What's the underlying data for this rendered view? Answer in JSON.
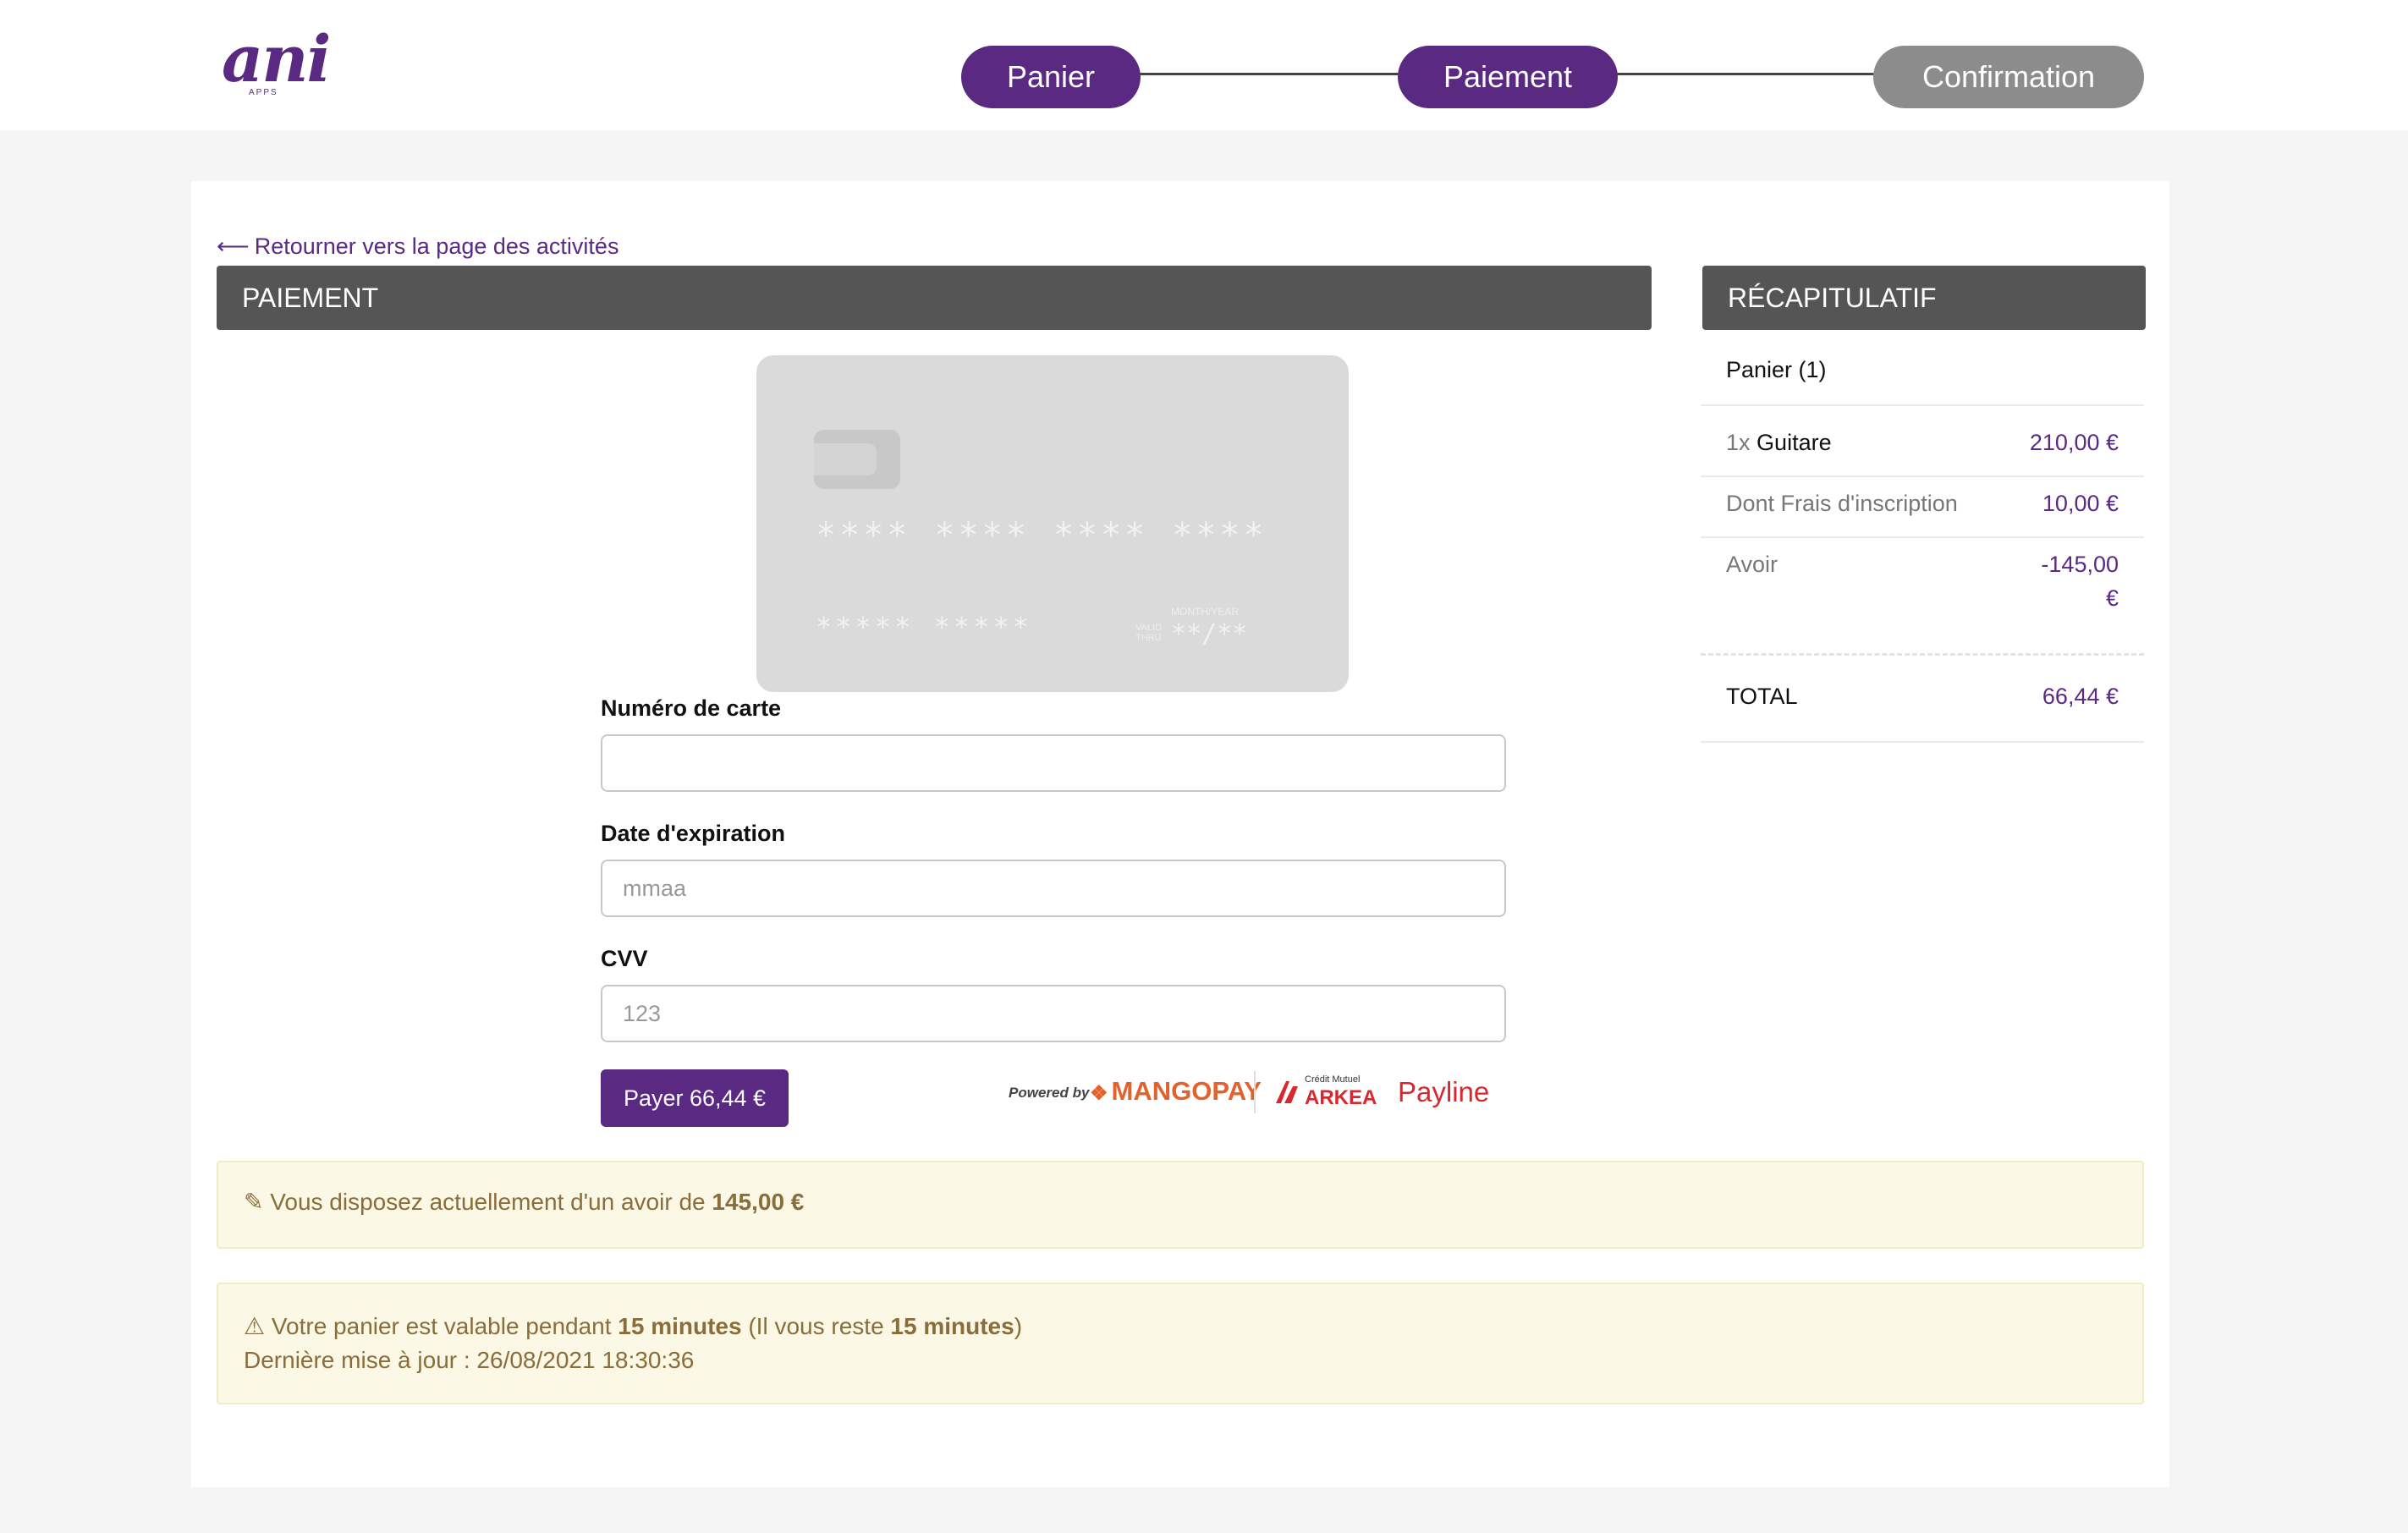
{
  "header": {
    "logo_text": "ani",
    "logo_subtext": "APPS",
    "steps": [
      {
        "label": "Panier",
        "state": "active"
      },
      {
        "label": "Paiement",
        "state": "active"
      },
      {
        "label": "Confirmation",
        "state": "inactive"
      }
    ]
  },
  "main": {
    "back_link": "Retourner vers la page des activités",
    "payment_header": "PAIEMENT",
    "card_preview": {
      "number_mask": "**** **** **** ****",
      "name_mask": "***** *****",
      "valid_thru": "VALID THRU",
      "month_year": "MONTH/YEAR",
      "expiry_mask": "**/**"
    },
    "form": {
      "card_number_label": "Numéro de carte",
      "card_number_placeholder": "",
      "expiry_label": "Date d'expiration",
      "expiry_placeholder": "mmaa",
      "cvv_label": "CVV",
      "cvv_placeholder": "123",
      "pay_button": "Payer 66,44 €"
    },
    "providers": {
      "powered_by": "Powered by",
      "mangopay": "MANGOPAY",
      "arkea_small": "Crédit Mutuel",
      "arkea": "ARKEA",
      "payline": "Payline"
    }
  },
  "summary": {
    "header": "RÉCAPITULATIF",
    "cart_label": "Panier (1)",
    "items": [
      {
        "qty": "1x",
        "name": "Guitare",
        "price": "210,00 €"
      }
    ],
    "fees": {
      "label": "Dont Frais d'inscription",
      "price": "10,00 €"
    },
    "credit": {
      "label": "Avoir",
      "price_line1": "-145,00",
      "price_line2": "€"
    },
    "total": {
      "label": "TOTAL",
      "price": "66,44 €"
    }
  },
  "alerts": {
    "credit": {
      "prefix": "Vous disposez actuellement d'un avoir de",
      "amount": "145,00 €"
    },
    "timer": {
      "part1": "Votre panier est valable pendant",
      "duration": "15 minutes",
      "part2": "(Il vous reste",
      "remaining": "15 minutes",
      "part3": ")",
      "updated": "Dernière mise à jour : 26/08/2021 18:30:36"
    }
  },
  "colors": {
    "brand": "#5a2a82",
    "header_bar": "#555555",
    "alert_bg": "#fbf8e5",
    "alert_text": "#8a6d3b"
  }
}
